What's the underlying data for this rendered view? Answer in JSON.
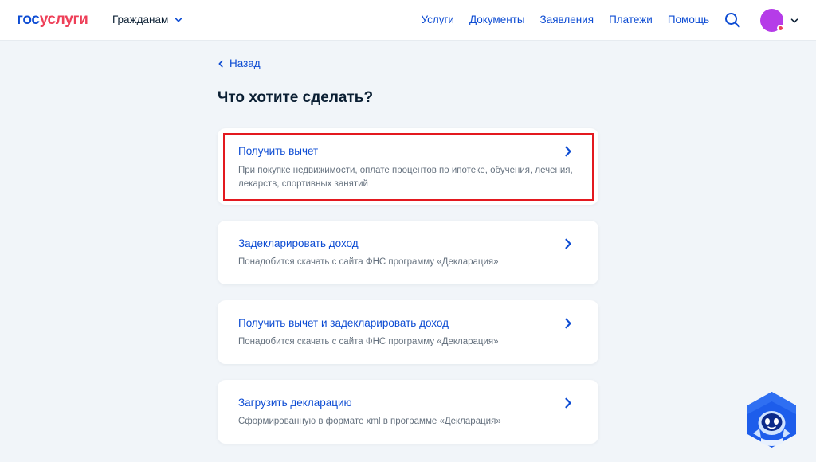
{
  "header": {
    "logo": {
      "part1": "гос",
      "part2": "услуги"
    },
    "audience_label": "Гражданам",
    "nav": [
      "Услуги",
      "Документы",
      "Заявления",
      "Платежи",
      "Помощь"
    ],
    "avatar_color": "#b53ce8"
  },
  "main": {
    "back_label": "Назад",
    "title": "Что хотите сделать?",
    "options": [
      {
        "title": "Получить вычет",
        "description": "При покупке недвижимости, оплате процентов по ипотеке, обучения, лечения, лекарств, спортивных занятий",
        "highlighted": true
      },
      {
        "title": "Задекларировать доход",
        "description": "Понадобится скачать с сайта ФНС программу «Декларация»"
      },
      {
        "title": "Получить вычет и задекларировать доход",
        "description": "Понадобится скачать с сайта ФНС программу «Декларация»"
      },
      {
        "title": "Загрузить декларацию",
        "description": "Сформированную в формате xml в программе «Декларация»"
      }
    ]
  },
  "colors": {
    "accent": "#0d4cd3",
    "logo_red": "#ee3f58",
    "highlight": "#e3191f",
    "background": "#f1f5f9"
  },
  "icons": {
    "audience_dropdown": "chevron-down-icon",
    "back": "chevron-left-icon",
    "search": "search-icon",
    "option_arrow": "chevron-right-icon",
    "assistant": "robot-assistant-icon"
  }
}
